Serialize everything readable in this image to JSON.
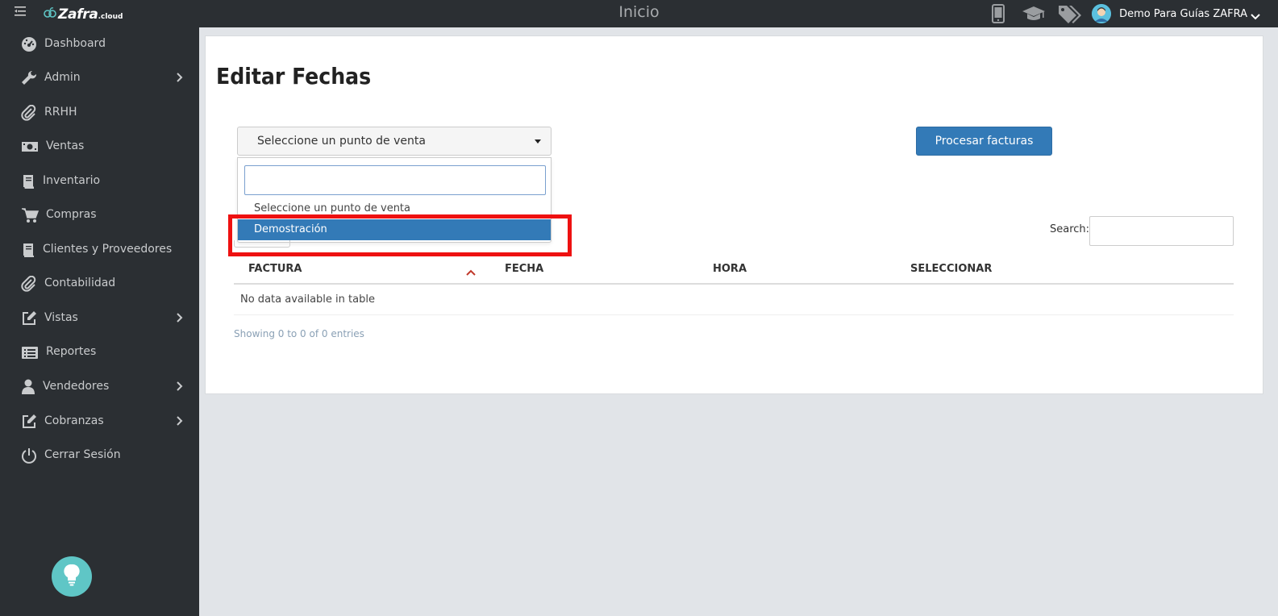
{
  "app": {
    "brand_name": "Zafra",
    "brand_tld": ".cloud",
    "page_title": "Inicio",
    "user_name": "Demo Para Guías ZAFRA",
    "icons": [
      "mobile-icon",
      "graduation-cap-icon",
      "tags-icon",
      "user-avatar-icon",
      "chevron-down-icon"
    ]
  },
  "sidebar": {
    "items": [
      {
        "label": "Dashboard",
        "icon": "dashboard-icon",
        "has_submenu": false
      },
      {
        "label": "Admin",
        "icon": "wrench-icon",
        "has_submenu": true
      },
      {
        "label": "RRHH",
        "icon": "paperclip-icon",
        "has_submenu": false
      },
      {
        "label": "Ventas",
        "icon": "money-icon",
        "has_submenu": false
      },
      {
        "label": "Inventario",
        "icon": "book-icon",
        "has_submenu": false
      },
      {
        "label": "Compras",
        "icon": "cart-icon",
        "has_submenu": false
      },
      {
        "label": "Clientes y Proveedores",
        "icon": "book-icon",
        "has_submenu": false
      },
      {
        "label": "Contabilidad",
        "icon": "paperclip-icon",
        "has_submenu": false
      },
      {
        "label": "Vistas",
        "icon": "edit-icon",
        "has_submenu": true
      },
      {
        "label": "Reportes",
        "icon": "list-icon",
        "has_submenu": false
      },
      {
        "label": "Vendedores",
        "icon": "user-icon",
        "has_submenu": true
      },
      {
        "label": "Cobranzas",
        "icon": "edit-icon",
        "has_submenu": true
      },
      {
        "label": "Cerrar Sesión",
        "icon": "power-icon",
        "has_submenu": false
      }
    ],
    "help_icon": "lightbulb-icon"
  },
  "main": {
    "heading_strong": "Editar",
    "heading_rest": " Fechas",
    "select": {
      "value": "Seleccione un punto de venta",
      "search_value": "",
      "options": [
        {
          "label": "Seleccione un punto de venta",
          "highlighted": false
        },
        {
          "label": "Demostración",
          "highlighted": true
        }
      ]
    },
    "process_button": "Procesar facturas",
    "search_label": "Search:",
    "search_value": "",
    "table": {
      "columns": [
        "FACTURA",
        "FECHA",
        "HORA",
        "SELECCIONAR"
      ],
      "sorted_column": "FACTURA",
      "empty_message": "No data available in table",
      "info": "Showing 0 to 0 of 0 entries"
    }
  },
  "colors": {
    "sidebar_bg": "#2b2f33",
    "primary": "#337ab7",
    "highlight_frame": "#ee1111",
    "help_bulb": "#5fc6c6",
    "sort_icon": "#c0392b"
  }
}
